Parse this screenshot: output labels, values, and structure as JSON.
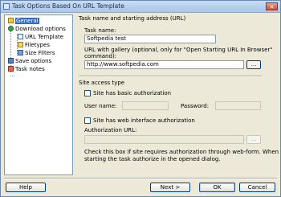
{
  "window": {
    "title": "Task Options Based On URL Template",
    "close_glyph": "✕"
  },
  "nav_tree": {
    "items": [
      {
        "label": "General",
        "icon": "general-icon",
        "selected": true
      },
      {
        "label": "Download options",
        "icon": "download-icon",
        "selected": false
      },
      {
        "label": "URL Template",
        "icon": "url-template-icon",
        "selected": false
      },
      {
        "label": "Filetypes",
        "icon": "filetypes-icon",
        "selected": false
      },
      {
        "label": "Size Filters",
        "icon": "size-filters-icon",
        "selected": false
      },
      {
        "label": "Save options",
        "icon": "save-options-icon",
        "selected": false
      },
      {
        "label": "Task notes",
        "icon": "task-notes-icon",
        "selected": false
      }
    ]
  },
  "task_section": {
    "heading": "Task name and starting address (URL)",
    "task_name_label": "Task name:",
    "task_name_value": "Softpedia test",
    "url_label_line1": "URL with gallery (optional, only for \"Open Starting URL In Browser\"",
    "url_label_line2": "command):",
    "url_value": "http://www.softpedia.com",
    "browse_label": "..."
  },
  "access_section": {
    "heading": "Site access type",
    "basic_auth_label": "Site has basic authorization",
    "basic_auth_checked": false,
    "username_label": "User name:",
    "username_value": "",
    "password_label": "Password:",
    "password_value": "",
    "web_auth_label": "Site has web interface authorization",
    "web_auth_checked": false,
    "auth_url_label": "Authorization URL:",
    "auth_url_value": "",
    "auth_browse_label": "...",
    "note_line1": "Check this box if site requires authorization through web-form. When",
    "note_line2": "starting the task authorize in the opened dialog."
  },
  "footer": {
    "help_label": "Help",
    "next_label": "Next >",
    "ok_label": "OK",
    "cancel_label": "Cancel"
  }
}
